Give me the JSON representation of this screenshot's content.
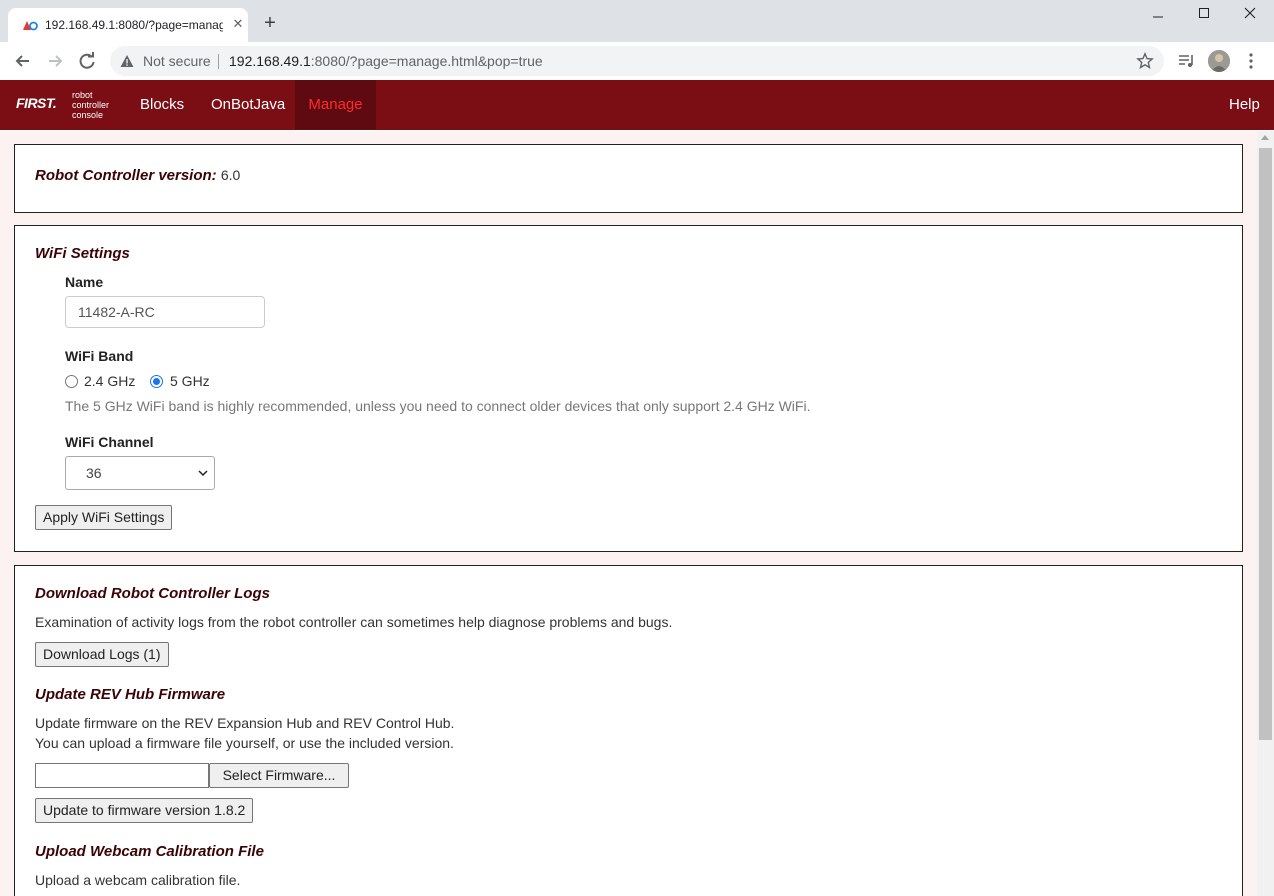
{
  "browser": {
    "tab_title": "192.168.49.1:8080/?page=manage.html&pop=true",
    "security_label": "Not secure",
    "url_host": "192.168.49.1",
    "url_rest": ":8080/?page=manage.html&pop=true"
  },
  "app": {
    "logo_text": "FIRST.",
    "logo_sub": [
      "robot",
      "controller",
      "console"
    ],
    "nav": {
      "blocks": "Blocks",
      "onbotjava": "OnBotJava",
      "manage": "Manage",
      "help": "Help"
    },
    "accent_color": "#7b0d14",
    "active_color": "#ff2b2b"
  },
  "version": {
    "label": "Robot Controller version:",
    "value": "6.0"
  },
  "wifi": {
    "heading": "WiFi Settings",
    "name_label": "Name",
    "name_value": "11482-A-RC",
    "band_label": "WiFi Band",
    "band_options": [
      "2.4 GHz",
      "5 GHz"
    ],
    "band_selected": "5 GHz",
    "band_note": "The 5 GHz WiFi band is highly recommended, unless you need to connect older devices that only support 2.4 GHz WiFi.",
    "channel_label": "WiFi Channel",
    "channel_value": "36",
    "apply_button": "Apply WiFi Settings"
  },
  "logs": {
    "heading": "Download Robot Controller Logs",
    "description": "Examination of activity logs from the robot controller can sometimes help diagnose problems and bugs.",
    "download_button": "Download Logs (1)"
  },
  "firmware": {
    "heading": "Update REV Hub Firmware",
    "line1": "Update firmware on the REV Expansion Hub and REV Control Hub.",
    "line2": "You can upload a firmware file yourself, or use the included version.",
    "select_button": "Select Firmware...",
    "update_button": "Update to firmware version 1.8.2"
  },
  "webcam": {
    "heading": "Upload Webcam Calibration File",
    "description": "Upload a webcam calibration file."
  }
}
